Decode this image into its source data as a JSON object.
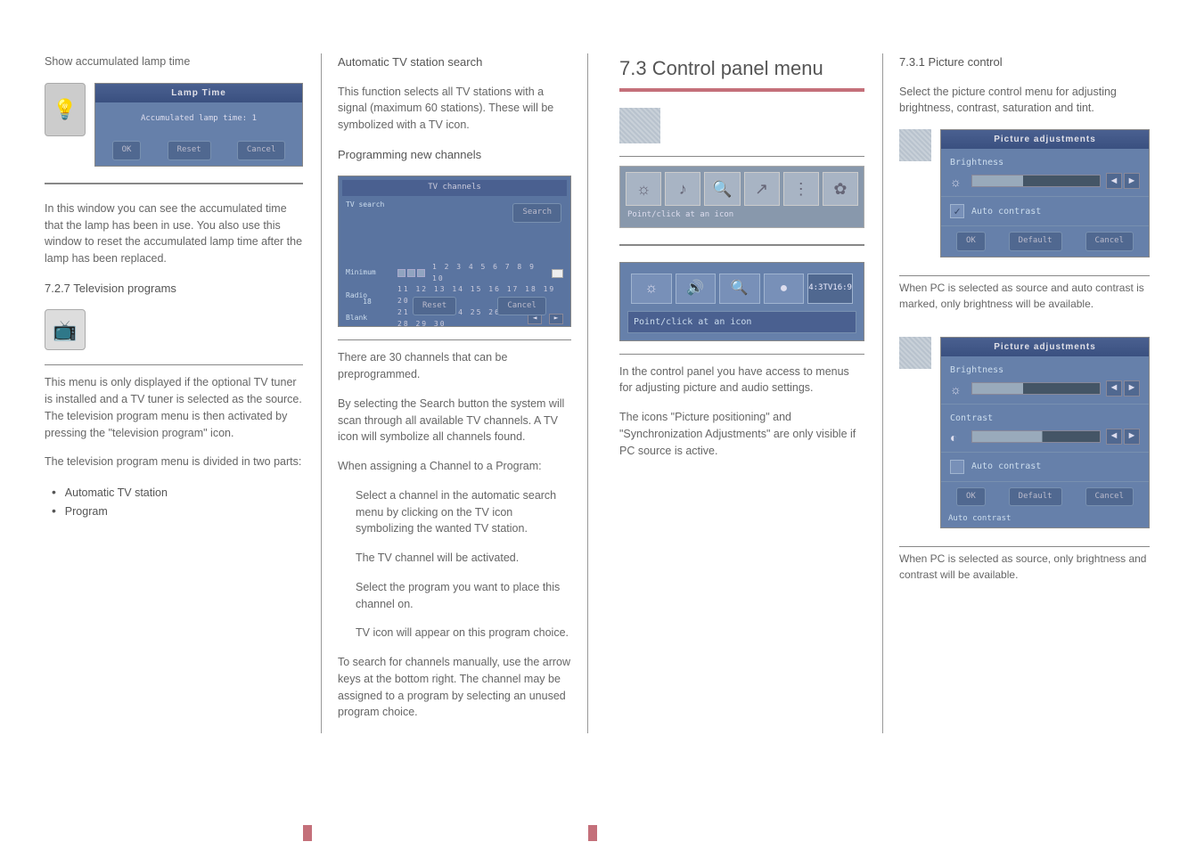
{
  "col1": {
    "heading1": "Show accumulated lamp time",
    "lamp_window_title": "Lamp Time",
    "lamp_window_text": "Accumulated lamp time: 1",
    "lamp_ok": "OK",
    "lamp_reset": "Reset",
    "lamp_cancel": "Cancel",
    "para1": "In this window you can see the accumulated time that the lamp has been in use. You also use this window to reset the accumulated lamp time after the lamp has been replaced.",
    "heading2": "7.2.7 Television programs",
    "para2": "This menu is only displayed if the optional TV tuner is installed and a TV tuner is selected as the source. The television program menu is then activated by pressing the \"television program\" icon.",
    "para3": "The television program menu is divided in two parts:",
    "bullet1": "Automatic TV station",
    "bullet2": "Program"
  },
  "col2": {
    "heading1": "Automatic TV station search",
    "para1": "This function selects all TV stations with a signal (maximum 60 stations). These will be symbolized with a TV icon.",
    "heading2": "Programming new channels",
    "tv_title": "TV channels",
    "tv_label_search": "TV search",
    "tv_label1": "Minimum",
    "tv_label2": "Radio",
    "tv_label3": "Blank",
    "tv_reset": "Reset",
    "tv_cancel": "Cancel",
    "para2": "There are 30 channels that can be preprogrammed.",
    "para3": "By selecting the Search button the system will scan through all available TV channels. A TV icon will symbolize all channels found.",
    "para4": "When assigning a Channel to a Program:",
    "indent1": "Select a channel in the automatic search menu by clicking on the TV icon symbolizing the wanted TV station.",
    "indent2": "The TV channel will be activated.",
    "indent3": "Select the program you want to place this channel on.",
    "indent4": "TV icon will appear on this program choice.",
    "para5": "To search for channels manually, use the arrow keys at the bottom right. The channel may be assigned to a program by selecting an unused program choice."
  },
  "col3": {
    "heading1": "7.3  Control panel menu",
    "strip_caption": "Point/click at an icon",
    "panel_hint": "Point/click at an icon",
    "panel_ratio1": "4:3",
    "panel_ratio2": "TV",
    "panel_ratio3": "16:9",
    "para1": "In the control panel you have access to menus for adjusting picture and audio settings.",
    "para2": "The icons \"Picture positioning\" and \"Synchronization Adjustments\" are only visible if PC source is active."
  },
  "col4": {
    "heading1": "7.3.1 Picture control",
    "para1": "Select the picture control menu for adjusting brightness, contrast, saturation and tint.",
    "adj_title": "Picture adjustments",
    "brightness": "Brightness",
    "contrast": "Contrast",
    "auto_contrast": "Auto contrast",
    "ok": "OK",
    "default": "Default",
    "cancel": "Cancel",
    "footer_hint": "Auto contrast",
    "caption1": "When PC is selected as source and auto contrast is marked, only brightness will be available.",
    "caption2": "When PC is selected as source, only brightness and contrast will be available."
  }
}
